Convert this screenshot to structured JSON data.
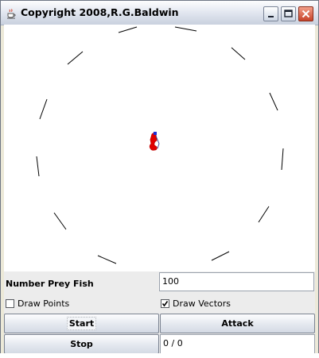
{
  "window": {
    "title": "Copyright 2008,R.G.Baldwin",
    "icons": {
      "app": "java-cup-icon",
      "minimize": "minimize-icon",
      "maximize": "maximize-icon",
      "close": "close-icon"
    },
    "colors": {
      "close": "#c7432a",
      "predator": "#e10000",
      "predator_head": "#1a2ed8"
    }
  },
  "controls": {
    "prey_count_label": "Number Prey Fish",
    "prey_count_value": "100",
    "draw_points_label": "Draw Points",
    "draw_points_checked": false,
    "draw_vectors_label": "Draw Vectors",
    "draw_vectors_checked": true,
    "start_label": "Start",
    "attack_label": "Attack",
    "stop_label": "Stop",
    "status_value": "0 / 0"
  }
}
